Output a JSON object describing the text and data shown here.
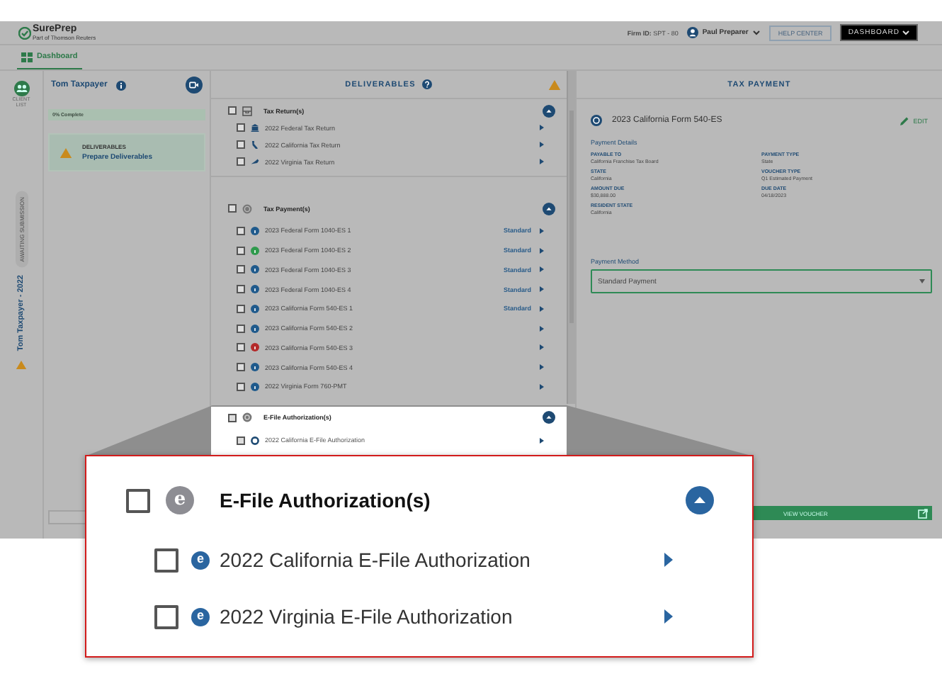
{
  "header": {
    "logo": "SurePrep",
    "logo_tagline": "Part of Thomson Reuters",
    "firm_label": "Firm ID:",
    "firm_id": "SPT - 80",
    "user": "Paul Preparer",
    "help_button": "HELP CENTER",
    "dashboard_button": "DASHBOARD"
  },
  "nav": [
    {
      "label": "Dashboard",
      "selected": true
    }
  ],
  "rail": {
    "client_list": "CLIENT LIST",
    "status": "AWAITING SUBMISSION",
    "client_year": "Tom Taxpayer - 2022"
  },
  "client": {
    "name": "Tom Taxpayer",
    "progress": "0% Complete",
    "card_title": "DELIVERABLES",
    "card_link": "Prepare Deliverables"
  },
  "deliverables": {
    "title": "DELIVERABLES",
    "groups": [
      {
        "kind": "return",
        "label": "Tax Return(s)",
        "checked": false,
        "expanded": true,
        "highlighted": false,
        "items": [
          {
            "kind": "federal",
            "label": "2022 Federal Tax Return",
            "checked": false
          },
          {
            "kind": "california",
            "label": "2022 California Tax Return",
            "checked": false
          },
          {
            "kind": "virginia",
            "label": "2022 Virginia Tax Return",
            "checked": false
          }
        ]
      },
      {
        "kind": "payment",
        "label": "Tax Payment(s)",
        "checked": false,
        "expanded": true,
        "highlighted": false,
        "items": [
          {
            "kind": "payment",
            "label": "2023 Federal Form 1040-ES 1",
            "checked": false,
            "color": "#1f5a8c",
            "method": "Standard"
          },
          {
            "kind": "payment",
            "label": "2023 Federal Form 1040-ES 2",
            "checked": false,
            "color": "#2e9a4c",
            "method": "Standard"
          },
          {
            "kind": "payment",
            "label": "2023 Federal Form 1040-ES 3",
            "checked": false,
            "color": "#1f5a8c",
            "method": "Standard"
          },
          {
            "kind": "payment",
            "label": "2023 Federal Form 1040-ES 4",
            "checked": false,
            "color": "#1f5a8c",
            "method": "Standard"
          },
          {
            "kind": "payment",
            "label": "2023 California Form 540-ES 1",
            "checked": false,
            "color": "#1f5a8c",
            "method": "Standard"
          },
          {
            "kind": "payment",
            "label": "2023 California Form 540-ES 2",
            "checked": false,
            "color": "#1f5a8c"
          },
          {
            "kind": "payment",
            "label": "2023 California Form 540-ES 3",
            "checked": false,
            "color": "#b42a2a"
          },
          {
            "kind": "payment",
            "label": "2023 California Form 540-ES 4",
            "checked": false,
            "color": "#1f5a8c"
          },
          {
            "kind": "payment",
            "label": "2022 Virginia Form 760-PMT",
            "checked": false,
            "color": "#1f5a8c"
          }
        ]
      },
      {
        "kind": "efile",
        "label": "E-File Authorization(s)",
        "checked": false,
        "expanded": true,
        "highlighted": true,
        "items": [
          {
            "kind": "efile",
            "label": "2022 California E-File Authorization",
            "checked": false
          }
        ]
      }
    ]
  },
  "payment": {
    "title": "TAX PAYMENT",
    "name": "2023 California Form 540-ES",
    "edit": "EDIT",
    "section": "Payment Details",
    "fields": [
      {
        "label": "PAYABLE TO",
        "value": "California Franchise Tax Board"
      },
      {
        "label": "PAYMENT TYPE",
        "value": "State"
      },
      {
        "label": "STATE",
        "value": "California"
      },
      {
        "label": "VOUCHER TYPE",
        "value": "Q1 Estimated Payment"
      },
      {
        "label": "AMOUNT DUE",
        "value": "$30,888.00"
      },
      {
        "label": "DUE DATE",
        "value": "04/18/2023"
      },
      {
        "label": "RESIDENT STATE",
        "value": "California"
      }
    ],
    "method_label": "Payment Method",
    "method_value": "Standard Payment",
    "voucher_button": "VIEW VOUCHER"
  },
  "callout": {
    "badge": "e",
    "label": "E-File Authorization(s)",
    "checked": false,
    "expanded": true,
    "items": [
      {
        "badge": "e",
        "label": "2022 California E-File Authorization",
        "checked": false
      },
      {
        "badge": "e",
        "label": "2022 Virginia E-File Authorization",
        "checked": false
      }
    ]
  }
}
